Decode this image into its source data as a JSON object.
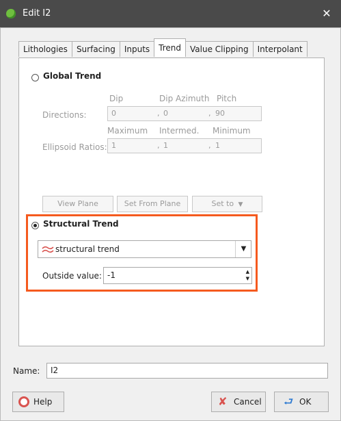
{
  "window": {
    "title": "Edit I2",
    "close_glyph": "✕"
  },
  "tabs": [
    {
      "label": "Lithologies"
    },
    {
      "label": "Surfacing"
    },
    {
      "label": "Inputs"
    },
    {
      "label": "Trend",
      "active": true
    },
    {
      "label": "Value Clipping"
    },
    {
      "label": "Interpolant"
    }
  ],
  "global_trend": {
    "radio_label": "Global Trend",
    "selected": false,
    "directions": {
      "label": "Directions:",
      "headers": [
        "Dip",
        "Dip Azimuth",
        "Pitch"
      ],
      "values": [
        "0",
        "0",
        "90"
      ]
    },
    "ellipsoid": {
      "label": "Ellipsoid Ratios:",
      "headers": [
        "Maximum",
        "Intermed.",
        "Minimum"
      ],
      "values": [
        "1",
        "1",
        "1"
      ]
    },
    "buttons": {
      "view_plane": "View Plane",
      "set_from_plane": "Set From Plane",
      "set_to": "Set to"
    }
  },
  "structural_trend": {
    "radio_label": "Structural Trend",
    "selected": true,
    "select_value": "structural trend",
    "outside_value_label": "Outside value:",
    "outside_value": "-1",
    "highlight_color": "#f55a1e"
  },
  "name": {
    "label": "Name:",
    "value": "I2"
  },
  "footer": {
    "help": "Help",
    "cancel": "Cancel",
    "ok": "OK"
  }
}
